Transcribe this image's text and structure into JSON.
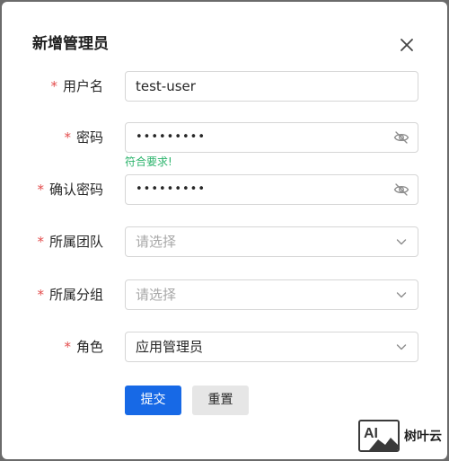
{
  "dialog": {
    "title": "新增管理员",
    "close_icon": "close-icon"
  },
  "form": {
    "required_mark": "*",
    "username": {
      "label": "用户名",
      "value": "test-user"
    },
    "password": {
      "label": "密码",
      "value": "•••••••••",
      "icon": "eye-off-icon",
      "hint": "符合要求!"
    },
    "confirm_password": {
      "label": "确认密码",
      "value": "•••••••••",
      "icon": "eye-off-icon"
    },
    "team": {
      "label": "所属团队",
      "placeholder": "请选择",
      "icon": "chevron-down-icon"
    },
    "group": {
      "label": "所属分组",
      "placeholder": "请选择",
      "icon": "chevron-down-icon"
    },
    "role": {
      "label": "角色",
      "value": "应用管理员",
      "icon": "chevron-down-icon"
    }
  },
  "actions": {
    "submit_label": "提交",
    "reset_label": "重置"
  },
  "watermark": {
    "logo_text": "AI",
    "brand": "树叶云"
  },
  "colors": {
    "primary": "#1769e6",
    "required": "#e34d4d",
    "success": "#2bb36b"
  }
}
